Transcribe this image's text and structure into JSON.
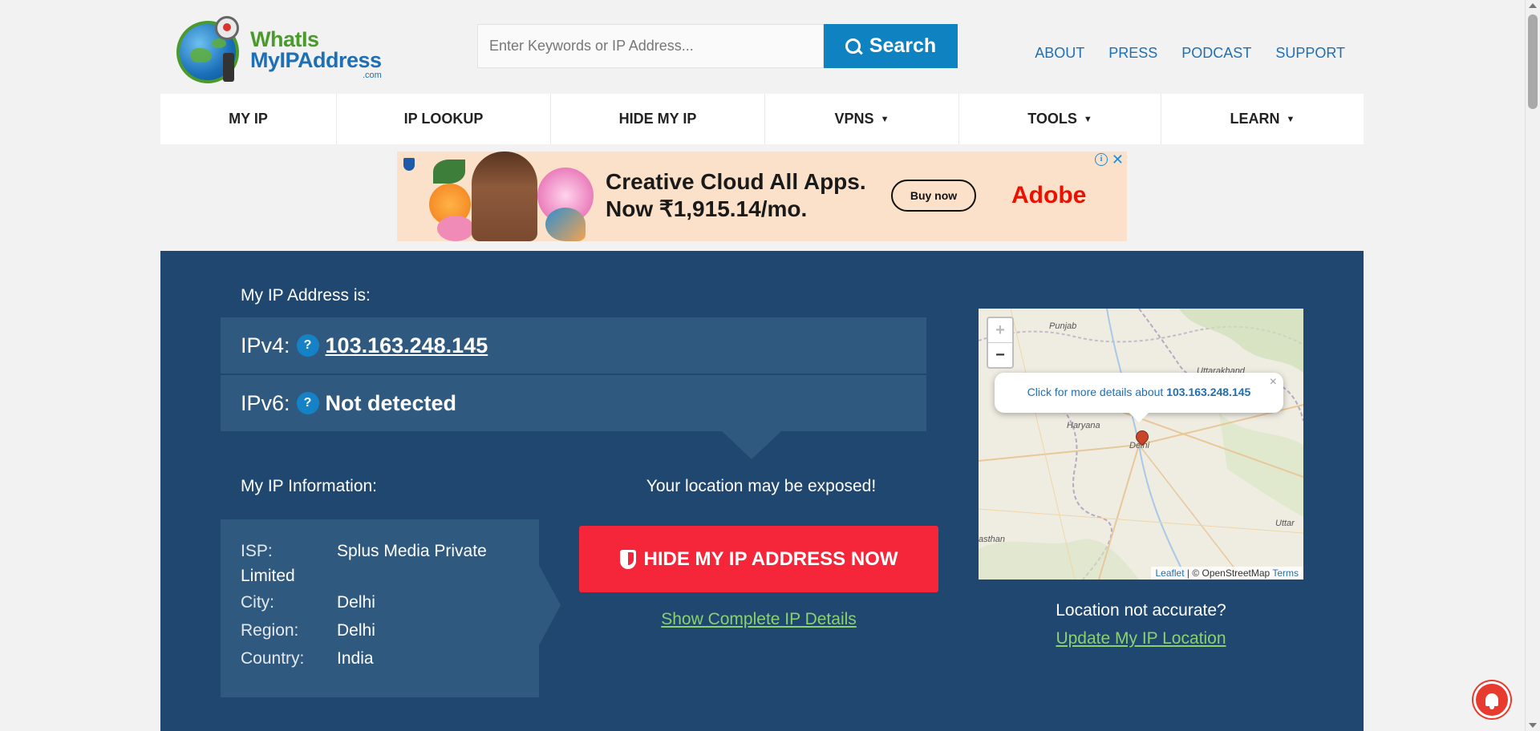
{
  "header": {
    "logo": {
      "line1": "WhatIs",
      "line2": "MyIPAddress",
      "suffix": ".com"
    },
    "search": {
      "placeholder": "Enter Keywords or IP Address...",
      "button_label": "Search",
      "icon": "search-icon"
    },
    "topnav": [
      "ABOUT",
      "PRESS",
      "PODCAST",
      "SUPPORT"
    ]
  },
  "mainnav": [
    {
      "label": "MY IP",
      "dropdown": false
    },
    {
      "label": "IP LOOKUP",
      "dropdown": false
    },
    {
      "label": "HIDE MY IP",
      "dropdown": false
    },
    {
      "label": "VPNS",
      "dropdown": true,
      "caret": "▼"
    },
    {
      "label": "TOOLS",
      "dropdown": true,
      "caret": "▼"
    },
    {
      "label": "LEARN",
      "dropdown": true,
      "caret": "▼"
    }
  ],
  "ad": {
    "line1": "Creative Cloud All Apps.",
    "line2": "Now ₹1,915.14/mo.",
    "cta": "Buy now",
    "brand": "Adobe",
    "info_glyph": "i",
    "close_glyph": "✕"
  },
  "main": {
    "my_ip_label": "My IP Address is:",
    "ipv4": {
      "key": "IPv4:",
      "help": "?",
      "value": "103.163.248.145"
    },
    "ipv6": {
      "key": "IPv6:",
      "help": "?",
      "value": "Not detected"
    },
    "info_label": "My IP Information:",
    "info": {
      "isp_key": "ISP:",
      "isp_value_1": "Splus Media Private",
      "isp_value_2": "Limited",
      "city_key": "City:",
      "city_value": "Delhi",
      "region_key": "Region:",
      "region_value": "Delhi",
      "country_key": "Country:",
      "country_value": "India"
    },
    "exposed_text": "Your location may be exposed!",
    "hide_button": "HIDE MY IP ADDRESS NOW",
    "details_link": "Show Complete IP Details",
    "accuracy_text": "Location not accurate?",
    "update_link": "Update My IP Location"
  },
  "map": {
    "zoom_in": "+",
    "zoom_out": "−",
    "popup_text": "Click for more details about",
    "popup_ip": "103.163.248.145",
    "popup_close": "×",
    "labels": [
      "Punjab",
      "Uttarakhand",
      "Haryana",
      "Delhi",
      "Uttar",
      "asthan"
    ],
    "attribution": {
      "leaflet": "Leaflet",
      "sep": " | © OpenStreetMap ",
      "terms": "Terms"
    }
  },
  "colors": {
    "primary": "#1f476f",
    "panel": "#30597f",
    "accent": "#f5263a",
    "link_green": "#8bd16f",
    "brand_blue": "#0f82c2"
  }
}
